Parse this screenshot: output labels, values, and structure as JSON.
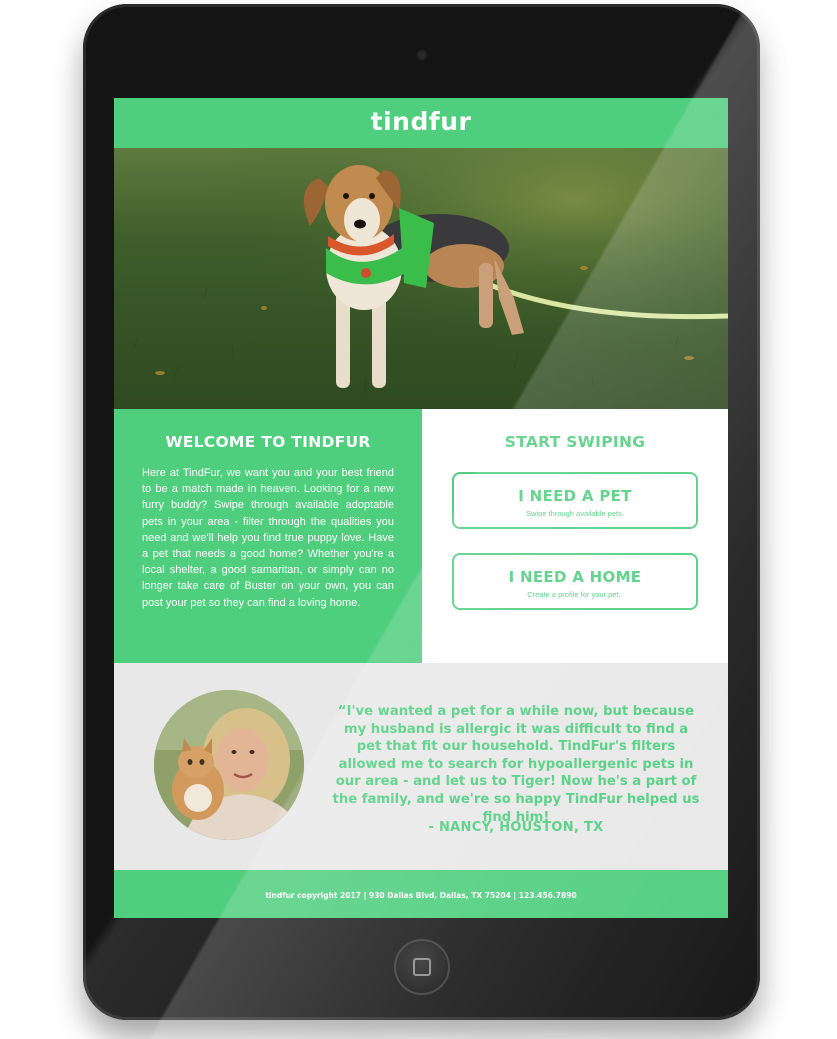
{
  "header": {
    "logo": "tindfur"
  },
  "welcome": {
    "title": "WELCOME TO TINDFUR",
    "body": "Here at TindFur, we want you and your best friend to be a match made in heaven. Looking for a new furry buddy? Swipe through available adoptable pets in your area - filter through the qualities you need and we'll help you find true puppy love. Have a pet that needs a good home? Whether you're a local shelter, a good samaritan, or simply can no longer take care of Buster on your own, you can post your pet so they can find a loving home."
  },
  "swipe": {
    "title": "START SWIPING",
    "need_pet": {
      "label": "I NEED A PET",
      "sub": "Swipe through available pets."
    },
    "need_home": {
      "label": "I NEED A HOME",
      "sub": "Create a profile for your pet.."
    }
  },
  "testimonial": {
    "quote": "“I've wanted a pet for a while now, but because my husband is allergic it was difficult to find a pet that fit our household. TindFur's filters allowed me to search for hypoallergenic pets in our area - and let us to Tiger! Now he's a part of the family, and we're so happy TindFur helped us find him!",
    "author": "- NANCY, HOUSTON, TX"
  },
  "footer": {
    "text": "tindfur copyright 2017 | 930 Dallas Blvd, Dallas, TX 75204 | 123.456.7890"
  },
  "colors": {
    "accent": "#4fce7e",
    "device": "#141414",
    "testimonial_bg": "#e8e8e8"
  },
  "icons": {
    "home_button": "home-square-icon",
    "camera": "camera-dot-icon"
  }
}
